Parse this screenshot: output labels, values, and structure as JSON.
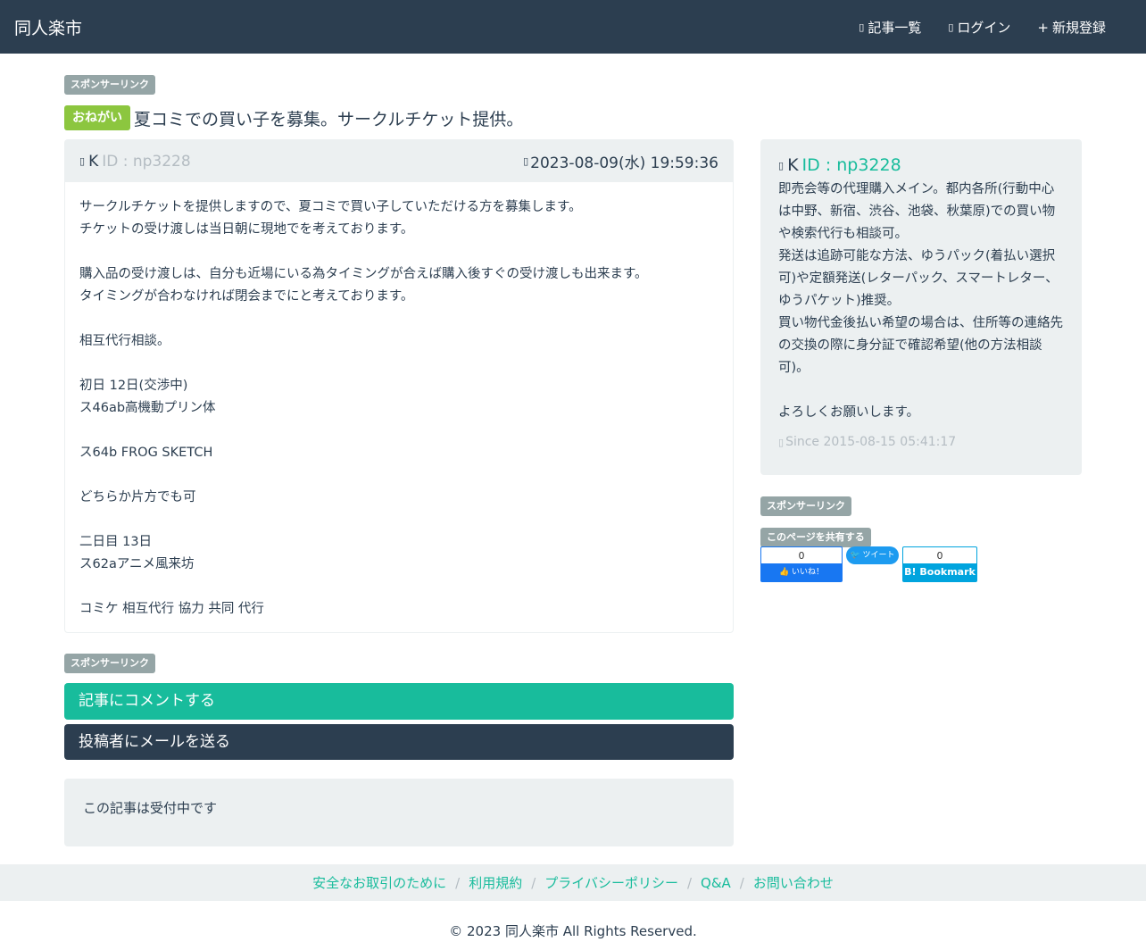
{
  "header": {
    "brand": "同人楽市",
    "nav": [
      {
        "icon": "list-icon",
        "glyph": "▯",
        "label": "記事一覧"
      },
      {
        "icon": "login-icon",
        "glyph": "▯",
        "label": "ログイン"
      },
      {
        "icon": "plus-icon",
        "glyph": "+",
        "label": "新規登録"
      }
    ]
  },
  "sponsor_label": "スポンサーリンク",
  "share_label": "このページを共有する",
  "post": {
    "badge": "おねがい",
    "title": "夏コミでの買い子を募集。サークルチケット提供。",
    "author_name": "K",
    "author_id": "ID : np3228",
    "date": "2023-08-09(水) 19:59:36",
    "icon_glyph": "▯",
    "body": "サークルチケットを提供しますので、夏コミで買い子していただける方を募集します。\nチケットの受け渡しは当日朝に現地でを考えております。\n\n購入品の受け渡しは、自分も近場にいる為タイミングが合えば購入後すぐの受け渡しも出来ます。\nタイミングが合わなければ閉会までにと考えております。\n\n相互代行相談。\n\n初日 12日(交渉中)\nス46ab高機動プリン体\n\nス64b FROG SKETCH\n\nどちらか片方でも可\n\n二日目 13日\nス62aアニメ風来坊\n\nコミケ 相互代行 協力 共同 代行"
  },
  "profile": {
    "name": "K",
    "id": "ID : np3228",
    "bio": "即売会等の代理購入メイン。都内各所(行動中心は中野、新宿、渋谷、池袋、秋葉原)での買い物や検索代行も相談可。\n発送は追跡可能な方法、ゆうパック(着払い選択可)や定額発送(レターパック、スマートレター、ゆうパケット)推奨。\n買い物代金後払い希望の場合は、住所等の連絡先の交換の際に身分証で確認希望(他の方法相談可)。\n\nよろしくお願いします。",
    "since": "Since 2015-08-15 05:41:17"
  },
  "share": {
    "fb_count": "0",
    "fb_label": "いいね！",
    "tw_label": "ツイート",
    "hb_count": "0",
    "hb_label": "B! Bookmark"
  },
  "actions": {
    "comment": "記事にコメントする",
    "mail": "投稿者にメールを送る"
  },
  "status": "この記事は受付中です",
  "footer": {
    "links": [
      "安全なお取引のために",
      "利用規約",
      "プライバシーポリシー",
      "Q&A",
      "お問い合わせ"
    ],
    "separator": "/",
    "copyright": "© 2023 同人楽市 All Rights Reserved."
  },
  "colors": {
    "navbar": "#2c3e50",
    "accent": "#18bc9c",
    "badge": "#8cc63f",
    "panel": "#ecf0f1",
    "label": "#95a5a6"
  }
}
